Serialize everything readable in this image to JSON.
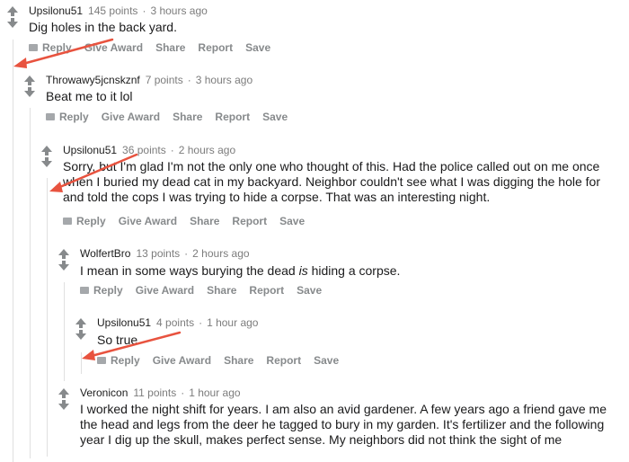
{
  "comments": [
    {
      "user": "Upsilonu51",
      "points": "145 points",
      "time": "3 hours ago",
      "body": "Dig holes in the back yard."
    },
    {
      "user": "Throwawy5jcnskznf",
      "points": "7 points",
      "time": "3 hours ago",
      "body": "Beat me to it lol"
    },
    {
      "user": "Upsilonu51",
      "points": "36 points",
      "time": "2 hours ago",
      "body_lines": [
        "Sorry, but I'm glad I'm not the only one who thought of this. Had the police called out on me once",
        "when I buried my dead cat in my backyard. Neighbor couldn't see what I was digging the hole for",
        "and told the cops I was trying to hide a corpse. That was an interesting night."
      ]
    },
    {
      "user": "WolfertBro",
      "points": "13 points",
      "time": "2 hours ago",
      "body_pre": "I mean in some ways burying the dead ",
      "body_em": "is",
      "body_post": " hiding a corpse."
    },
    {
      "user": "Upsilonu51",
      "points": "4 points",
      "time": "1 hour ago",
      "body": "So true"
    },
    {
      "user": "Veronicon",
      "points": "11 points",
      "time": "1 hour ago",
      "body_lines": [
        "I worked the night shift for years. I am also an avid gardener. A few years ago a friend gave me",
        "the head and legs from the deer he tagged to bury in my garden. It's fertilizer and the following",
        "year I dig up the skull, makes perfect sense. My neighbors did not think the sight of me"
      ]
    }
  ],
  "actions": {
    "reply": "Reply",
    "give_award": "Give Award",
    "share": "Share",
    "report": "Report",
    "save": "Save"
  },
  "separator": "·",
  "colors": {
    "annotation_arrow": "#e8533f",
    "action_text": "#878a8c"
  },
  "icons": {
    "upvote": "upvote-arrow-icon",
    "downvote": "downvote-arrow-icon",
    "reply": "reply-bubble-icon"
  }
}
